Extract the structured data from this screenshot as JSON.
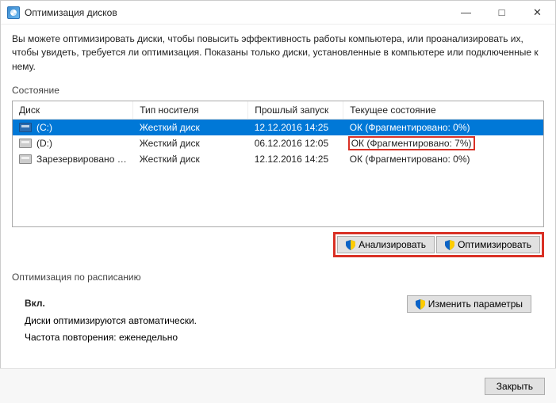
{
  "window": {
    "title": "Оптимизация дисков"
  },
  "description": "Вы можете оптимизировать диски, чтобы повысить эффективность работы  компьютера, или проанализировать их, чтобы увидеть, требуется ли оптимизация. Показаны только диски, установленные в компьютере или подключенные к нему.",
  "state_label": "Состояние",
  "columns": {
    "disk": "Диск",
    "media": "Тип носителя",
    "last": "Прошлый запуск",
    "state": "Текущее состояние"
  },
  "rows": [
    {
      "disk": "(C:)",
      "media": "Жесткий диск",
      "last": "12.12.2016 14:25",
      "state": "ОК (Фрагментировано: 0%)",
      "selected": true
    },
    {
      "disk": "(D:)",
      "media": "Жесткий диск",
      "last": "06.12.2016 12:05",
      "state": "ОК (Фрагментировано: 7%)",
      "highlight": true
    },
    {
      "disk": "Зарезервировано …",
      "media": "Жесткий диск",
      "last": "12.12.2016 14:25",
      "state": "ОК (Фрагментировано: 0%)"
    }
  ],
  "buttons": {
    "analyze": "Анализировать",
    "optimize": "Оптимизировать",
    "change": "Изменить параметры",
    "close": "Закрыть"
  },
  "schedule": {
    "label": "Оптимизация по расписанию",
    "status": "Вкл.",
    "line1": "Диски оптимизируются автоматически.",
    "line2": "Частота повторения: еженедельно"
  }
}
